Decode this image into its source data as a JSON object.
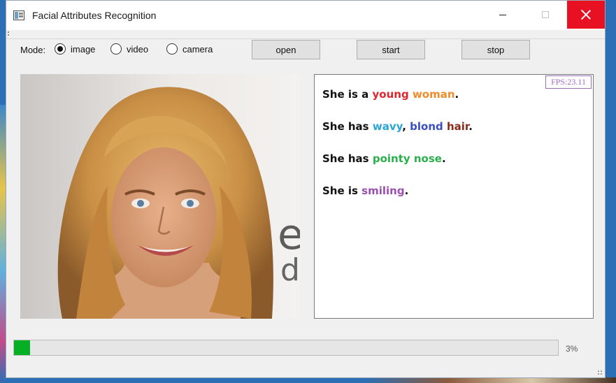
{
  "window": {
    "title": "Facial Attributes Recognition",
    "icon": "app-window-icon"
  },
  "toolbar": {
    "mode_label": "Mode:",
    "modes": [
      {
        "label": "image",
        "checked": true
      },
      {
        "label": "video",
        "checked": false
      },
      {
        "label": "camera",
        "checked": false
      }
    ],
    "open_label": "open",
    "start_label": "start",
    "stop_label": "stop"
  },
  "results": {
    "fps": "FPS:23.11",
    "lines": [
      [
        {
          "text": "She is a ",
          "color": "#111111"
        },
        {
          "text": "young",
          "color": "#e0262c"
        },
        {
          "text": " ",
          "color": "#111111"
        },
        {
          "text": "woman",
          "color": "#f08a2a"
        },
        {
          "text": ".",
          "color": "#111111"
        }
      ],
      [
        {
          "text": "She has ",
          "color": "#111111"
        },
        {
          "text": "wavy",
          "color": "#2aa6d6"
        },
        {
          "text": ", ",
          "color": "#111111"
        },
        {
          "text": "blond",
          "color": "#3b4fc2"
        },
        {
          "text": " ",
          "color": "#111111"
        },
        {
          "text": "hair",
          "color": "#8c2a1a"
        },
        {
          "text": ".",
          "color": "#111111"
        }
      ],
      [
        {
          "text": "She has ",
          "color": "#111111"
        },
        {
          "text": "pointy nose",
          "color": "#2ab04a"
        },
        {
          "text": ".",
          "color": "#111111"
        }
      ],
      [
        {
          "text": "She is ",
          "color": "#111111"
        },
        {
          "text": "smiling",
          "color": "#9b4fb0"
        },
        {
          "text": ".",
          "color": "#111111"
        }
      ]
    ]
  },
  "progress": {
    "value": 3,
    "label": "3%",
    "color": "#06b025"
  }
}
